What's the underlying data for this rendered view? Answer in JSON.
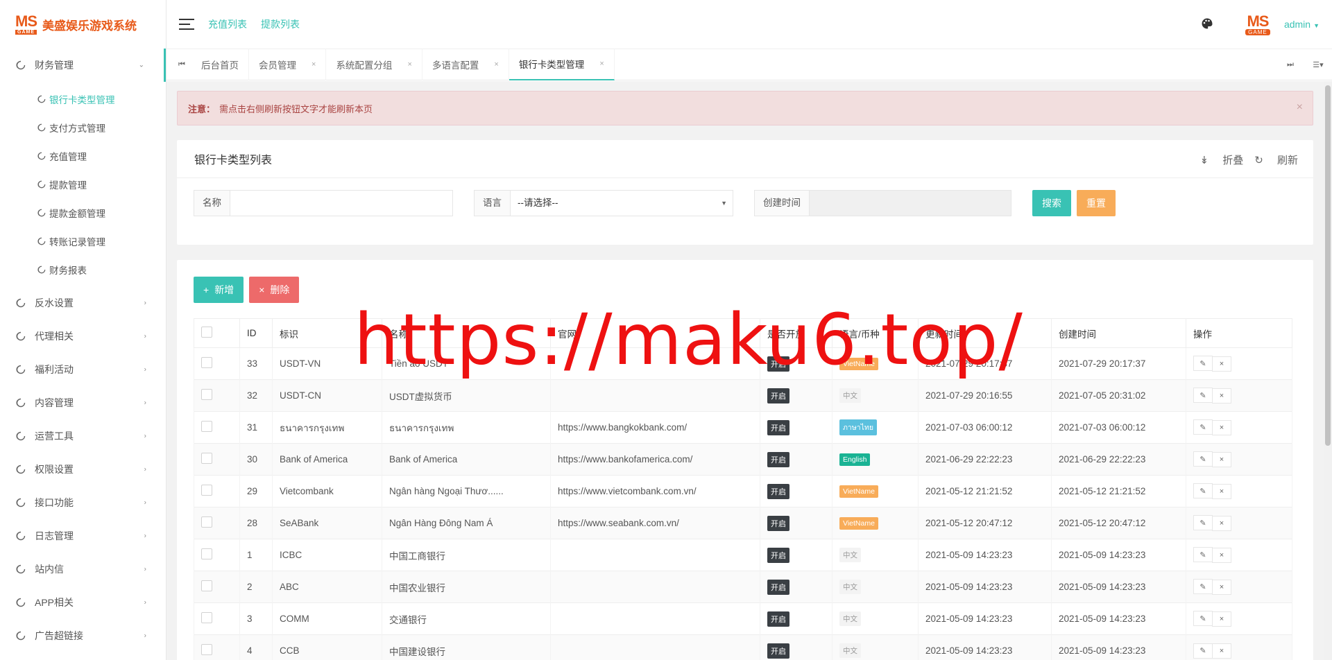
{
  "brand": {
    "mark": "MS",
    "mark_sub": "GAME",
    "name": "美盛娱乐游戏系统"
  },
  "header": {
    "links": [
      "充值列表",
      "提款列表"
    ],
    "user": "admin",
    "avatar_mark": "MS",
    "avatar_sub": "GAME"
  },
  "sidebar": {
    "finance_label": "财务管理",
    "finance_items": [
      "银行卡类型管理",
      "支付方式管理",
      "充值管理",
      "提款管理",
      "提款金额管理",
      "转账记录管理",
      "财务报表"
    ],
    "menus": [
      "反水设置",
      "代理相关",
      "福利活动",
      "内容管理",
      "运营工具",
      "权限设置",
      "接口功能",
      "日志管理",
      "站内信",
      "APP相关",
      "广告超链接"
    ]
  },
  "tabs": [
    {
      "label": "后台首页",
      "closable": false
    },
    {
      "label": "会员管理",
      "closable": true
    },
    {
      "label": "系统配置分组",
      "closable": true
    },
    {
      "label": "多语言配置",
      "closable": true
    },
    {
      "label": "银行卡类型管理",
      "closable": true,
      "active": true
    }
  ],
  "notice": {
    "label": "注意：",
    "text": "需点击右侧刷新按钮文字才能刷新本页"
  },
  "search": {
    "title": "银行卡类型列表",
    "collapse": "折叠",
    "refresh": "刷新",
    "name_label": "名称",
    "name_value": "",
    "lang_label": "语言",
    "lang_value": "--请选择--",
    "created_label": "创建时间",
    "search_btn": "搜索",
    "reset_btn": "重置"
  },
  "list": {
    "add_btn": "新增",
    "delete_btn": "删除",
    "columns": [
      "ID",
      "标识",
      "名称",
      "官网",
      "是否开放",
      "语言/币种",
      "更新时间",
      "创建时间",
      "操作"
    ],
    "rows": [
      {
        "id": "33",
        "code": "USDT-VN",
        "name": "Tiền ảo USDT",
        "site": "",
        "open": "开启",
        "lang": "VietName",
        "lang_type": "vi",
        "updated": "2021-07-29 20:17:37",
        "created": "2021-07-29 20:17:37"
      },
      {
        "id": "32",
        "code": "USDT-CN",
        "name": "USDT虚拟货币",
        "site": "",
        "open": "开启",
        "lang": "中文",
        "lang_type": "zh",
        "updated": "2021-07-29 20:16:55",
        "created": "2021-07-05 20:31:02"
      },
      {
        "id": "31",
        "code": "ธนาคารกรุงเทพ",
        "name": "ธนาคารกรุงเทพ",
        "site": "https://www.bangkokbank.com/",
        "open": "开启",
        "lang": "ภาษาไทย",
        "lang_type": "th",
        "updated": "2021-07-03 06:00:12",
        "created": "2021-07-03 06:00:12"
      },
      {
        "id": "30",
        "code": "Bank of America",
        "name": "Bank of America",
        "site": "https://www.bankofamerica.com/",
        "open": "开启",
        "lang": "English",
        "lang_type": "en",
        "updated": "2021-06-29 22:22:23",
        "created": "2021-06-29 22:22:23"
      },
      {
        "id": "29",
        "code": "Vietcombank",
        "name": "Ngân hàng Ngoại Thươ......",
        "site": "https://www.vietcombank.com.vn/",
        "open": "开启",
        "lang": "VietName",
        "lang_type": "vi",
        "updated": "2021-05-12 21:21:52",
        "created": "2021-05-12 21:21:52"
      },
      {
        "id": "28",
        "code": "SeABank",
        "name": "Ngân Hàng Đông Nam Á",
        "site": "https://www.seabank.com.vn/",
        "open": "开启",
        "lang": "VietName",
        "lang_type": "vi",
        "updated": "2021-05-12 20:47:12",
        "created": "2021-05-12 20:47:12"
      },
      {
        "id": "1",
        "code": "ICBC",
        "name": "中国工商银行",
        "site": "",
        "open": "开启",
        "lang": "中文",
        "lang_type": "zh",
        "updated": "2021-05-09 14:23:23",
        "created": "2021-05-09 14:23:23"
      },
      {
        "id": "2",
        "code": "ABC",
        "name": "中国农业银行",
        "site": "",
        "open": "开启",
        "lang": "中文",
        "lang_type": "zh",
        "updated": "2021-05-09 14:23:23",
        "created": "2021-05-09 14:23:23"
      },
      {
        "id": "3",
        "code": "COMM",
        "name": "交通银行",
        "site": "",
        "open": "开启",
        "lang": "中文",
        "lang_type": "zh",
        "updated": "2021-05-09 14:23:23",
        "created": "2021-05-09 14:23:23"
      },
      {
        "id": "4",
        "code": "CCB",
        "name": "中国建设银行",
        "site": "",
        "open": "开启",
        "lang": "中文",
        "lang_type": "zh",
        "updated": "2021-05-09 14:23:23",
        "created": "2021-05-09 14:23:23"
      }
    ]
  },
  "watermark": "https://maku6.top/",
  "colors": {
    "accent": "#39c2b4",
    "brand": "#e85a1a",
    "danger": "#ed6a6a",
    "warning": "#f8ac59"
  }
}
